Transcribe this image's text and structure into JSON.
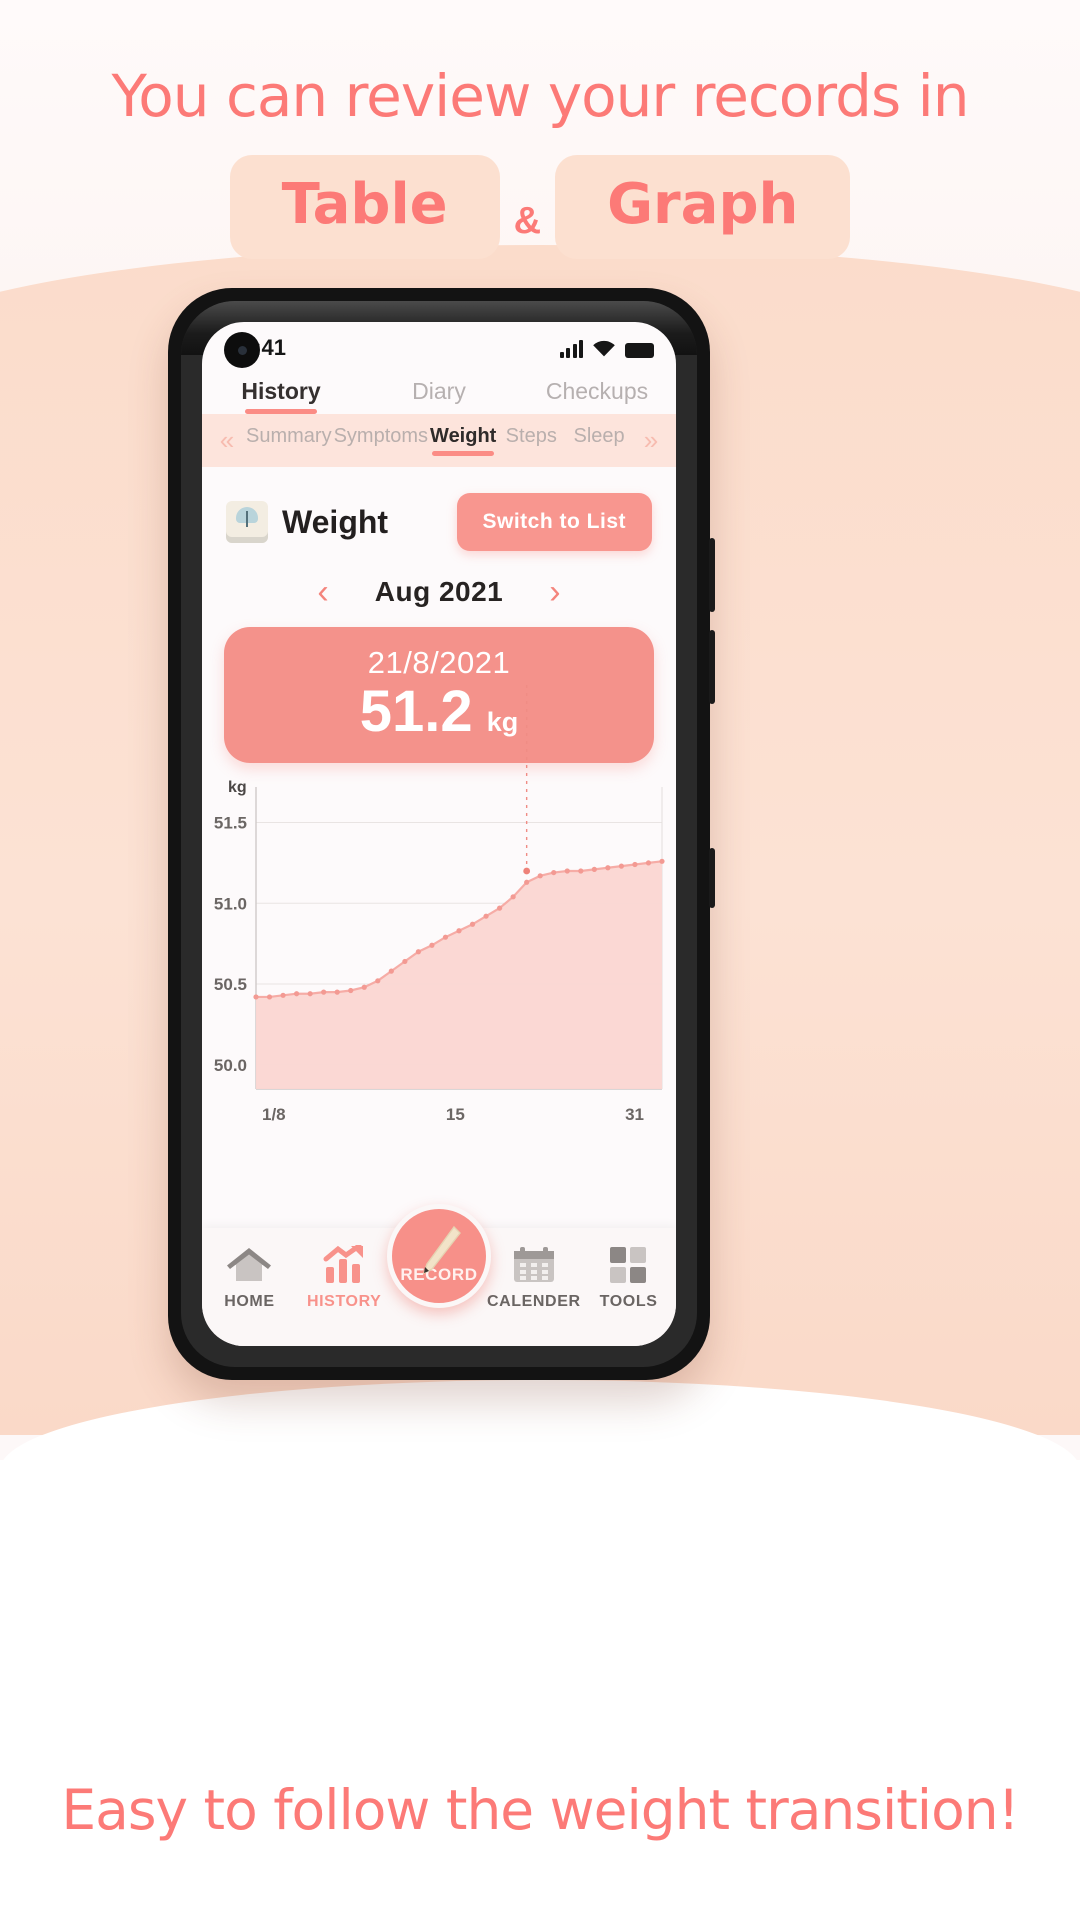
{
  "promo": {
    "headline": "You can review your records in",
    "badge_table": "Table",
    "badge_graph": "Graph",
    "ampersand": "&",
    "footer": "Easy to follow the weight transition!",
    "accent_color": "#FC7A77",
    "badge_bg": "#FCE0D0",
    "page_bg": "#FBDCCB"
  },
  "status_bar": {
    "time": "9:41",
    "signal_icon": "cellular-signal-icon",
    "wifi_icon": "wifi-icon",
    "battery_icon": "battery-icon"
  },
  "main_tabs": [
    {
      "label": "History",
      "active": true
    },
    {
      "label": "Diary",
      "active": false
    },
    {
      "label": "Checkups",
      "active": false
    }
  ],
  "sub_tabs": {
    "prev_icon": "«",
    "next_icon": "»",
    "items": [
      {
        "label": "Summary",
        "active": false
      },
      {
        "label": "Symptoms",
        "active": false
      },
      {
        "label": "Weight",
        "active": true
      },
      {
        "label": "Steps",
        "active": false
      },
      {
        "label": "Sleep",
        "active": false
      }
    ]
  },
  "section": {
    "icon": "weight-scale-icon",
    "title": "Weight",
    "switch_button": "Switch to List"
  },
  "month_nav": {
    "prev_icon": "chevron-left-icon",
    "prev_glyph": "‹",
    "label": "Aug 2021",
    "next_icon": "chevron-right-icon",
    "next_glyph": "›"
  },
  "value_card": {
    "date": "21/8/2021",
    "value": "51.2",
    "unit": "kg",
    "bg_color": "#F4928B"
  },
  "chart_data": {
    "type": "area",
    "title": "Weight",
    "xlabel": "",
    "ylabel": "kg",
    "unit_label": "kg",
    "ylim": [
      49.85,
      51.72
    ],
    "yticks": [
      "50.0",
      "50.5",
      "51.0",
      "51.5"
    ],
    "ytick_values": [
      50.0,
      50.5,
      51.0,
      51.5
    ],
    "xticks": [
      "1/8",
      "15",
      "31"
    ],
    "xtick_days": [
      1,
      15,
      31
    ],
    "grid": true,
    "legend": "none",
    "highlight_day": 21,
    "highlight_value": 51.2,
    "series": [
      {
        "name": "Weight (kg)",
        "line_color": "#F6ACA6",
        "fill_color": "#FBD6D2",
        "x": [
          1,
          2,
          3,
          4,
          5,
          6,
          7,
          8,
          9,
          10,
          11,
          12,
          13,
          14,
          15,
          16,
          17,
          18,
          19,
          20,
          21,
          22,
          23,
          24,
          25,
          26,
          27,
          28,
          29,
          30,
          31
        ],
        "values": [
          50.42,
          50.42,
          50.43,
          50.44,
          50.44,
          50.45,
          50.45,
          50.46,
          50.48,
          50.52,
          50.58,
          50.64,
          50.7,
          50.74,
          50.79,
          50.83,
          50.87,
          50.92,
          50.97,
          51.04,
          51.13,
          51.17,
          51.19,
          51.2,
          51.2,
          51.21,
          51.22,
          51.23,
          51.24,
          51.25,
          51.26
        ]
      }
    ]
  },
  "bottom_nav": [
    {
      "label": "HOME",
      "icon": "home-icon",
      "active": false
    },
    {
      "label": "HISTORY",
      "icon": "bar-chart-trend-icon",
      "active": true
    },
    {
      "label": "RECORD",
      "icon": "pencil-icon",
      "active": false,
      "fab": true
    },
    {
      "label": "CALENDER",
      "icon": "calendar-icon",
      "active": false
    },
    {
      "label": "TOOLS",
      "icon": "grid-blocks-icon",
      "active": false
    }
  ]
}
